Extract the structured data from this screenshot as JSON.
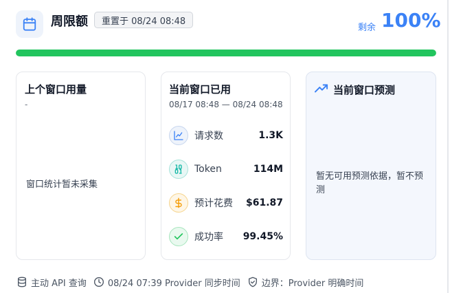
{
  "header": {
    "title": "周限额",
    "reset_badge": "重置于 08/24 08:48",
    "remaining_label": "剩余",
    "remaining_value": "100%",
    "progress_fraction": 1.0,
    "icon": "calendar-icon"
  },
  "colors": {
    "accent": "#3b82f6",
    "progress": "#22c55e",
    "chart_icon": "#3b82f6",
    "token_icon": "#14b8a6",
    "cost_icon": "#f59e0b",
    "success_icon": "#22c55e"
  },
  "panels": {
    "previous": {
      "title": "上个窗口用量",
      "dash": "-",
      "message": "窗口统计暂未采集"
    },
    "current": {
      "title": "当前窗口已用",
      "range": "08/17 08:48 — 08/24 08:48",
      "metrics": [
        {
          "icon": "line-chart-icon",
          "label": "请求数",
          "value": "1.3K"
        },
        {
          "icon": "binary-icon",
          "label": "Token",
          "value": "114M"
        },
        {
          "icon": "dollar-icon",
          "label": "预计花费",
          "value": "$61.87"
        },
        {
          "icon": "check-icon",
          "label": "成功率",
          "value": "99.45%"
        }
      ]
    },
    "forecast": {
      "icon": "trending-up-icon",
      "title": "当前窗口预测",
      "message": "暂无可用预测依据，暂不预测"
    }
  },
  "footer": {
    "items": [
      {
        "icon": "database-icon",
        "text": "主动 API 查询"
      },
      {
        "icon": "clock-icon",
        "text": "08/24 07:39 Provider 同步时间"
      },
      {
        "icon": "shield-check-icon",
        "text": "边界：Provider 明确时间"
      }
    ]
  }
}
